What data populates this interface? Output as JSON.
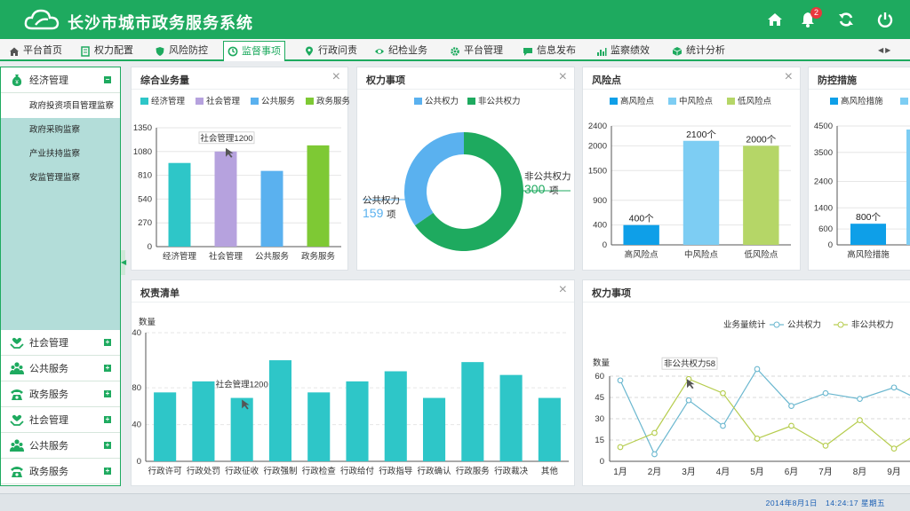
{
  "app": {
    "title": "长沙市城市政务服务系统",
    "notification_count": "2"
  },
  "header_icons": [
    "home-icon",
    "bell-icon",
    "refresh-icon",
    "power-icon"
  ],
  "tabs": [
    {
      "label": "平台首页",
      "icon": "home-icon"
    },
    {
      "label": "权力配置",
      "icon": "document-icon"
    },
    {
      "label": "风险防控",
      "icon": "shield-icon"
    },
    {
      "label": "监督事项",
      "icon": "clock-icon",
      "active": true
    },
    {
      "label": "行政问责",
      "icon": "location-icon"
    },
    {
      "label": "纪检业务",
      "icon": "eye-icon"
    },
    {
      "label": "平台管理",
      "icon": "gear-icon"
    },
    {
      "label": "信息发布",
      "icon": "chat-icon"
    },
    {
      "label": "监察绩效",
      "icon": "bar-chart-icon"
    },
    {
      "label": "统计分析",
      "icon": "cube-icon"
    }
  ],
  "sidebar": {
    "sections": [
      {
        "label": "经济管理",
        "icon": "money-bag-icon",
        "toggle": "−",
        "expanded": true
      },
      {
        "label": "社会管理",
        "icon": "heart-hands-icon",
        "toggle": "+"
      },
      {
        "label": "公共服务",
        "icon": "people-icon",
        "toggle": "+"
      },
      {
        "label": "政务服务",
        "icon": "phone-icon",
        "toggle": "+"
      },
      {
        "label": "社会管理",
        "icon": "heart-hands-icon",
        "toggle": "+"
      },
      {
        "label": "公共服务",
        "icon": "people-icon",
        "toggle": "+"
      },
      {
        "label": "政务服务",
        "icon": "phone-icon",
        "toggle": "+"
      }
    ],
    "sub_items": [
      "政府投资项目管理监察",
      "政府采购监察",
      "产业扶持监察",
      "安监管理监察"
    ],
    "active_sub": 0
  },
  "panels": {
    "business": {
      "title": "综合业务量",
      "close": "×"
    },
    "power": {
      "title": "权力事项",
      "close": "×"
    },
    "risk": {
      "title": "风险点",
      "close": "×"
    },
    "prevention": {
      "title": "防控措施"
    },
    "list": {
      "title": "权责清单",
      "close": "×"
    },
    "power_trend": {
      "title": "权力事项"
    }
  },
  "colors": {
    "primary": "#1eaa5f",
    "teal": "#2ec6c8",
    "purple": "#b6a2de",
    "blue": "#5ab1ef",
    "green": "#7ec934",
    "deep_blue": "#0e9fe8",
    "light_blue": "#7dcdf3",
    "light_green": "#b5d667"
  },
  "chart_data": [
    {
      "id": "business",
      "type": "bar",
      "categories": [
        "经济管理",
        "社会管理",
        "公共服务",
        "政务服务"
      ],
      "values": [
        950,
        1080,
        860,
        1150
      ],
      "colors": [
        "#2ec6c8",
        "#b6a2de",
        "#5ab1ef",
        "#7ec934"
      ],
      "ylim": [
        0,
        1350
      ],
      "yticks": [
        "0",
        "270",
        "540",
        "810",
        "1080",
        "1350"
      ],
      "legend": [
        "经济管理",
        "社会管理",
        "公共服务",
        "政务服务"
      ],
      "tooltip": "社会管理1200",
      "grid": true
    },
    {
      "id": "power",
      "type": "pie",
      "legend": [
        "公共权力",
        "非公共权力"
      ],
      "slices": [
        {
          "name": "公共权力",
          "value": 159,
          "color": "#5ab1ef",
          "label_name": "公共权力",
          "label_value": "159",
          "unit": "项"
        },
        {
          "name": "非公共权力",
          "value": 300,
          "color": "#1eaa5f",
          "label_name": "非公共权力",
          "label_value": "300",
          "unit": "项"
        }
      ]
    },
    {
      "id": "risk",
      "type": "bar",
      "categories": [
        "高风险点",
        "中风险点",
        "低风险点"
      ],
      "values": [
        400,
        2100,
        2000
      ],
      "labels": [
        "400个",
        "2100个",
        "2000个"
      ],
      "colors": [
        "#0e9fe8",
        "#7dcdf3",
        "#b5d667"
      ],
      "ylim": [
        0,
        2400
      ],
      "yticks": [
        "0",
        "400",
        "900",
        "1500",
        "2000",
        "2400"
      ],
      "legend": [
        "高风险点",
        "中风险点",
        "低风险点"
      ],
      "grid": true
    },
    {
      "id": "prevention",
      "type": "bar",
      "categories": [
        "高风险措施"
      ],
      "values": [
        800
      ],
      "labels": [
        "800个"
      ],
      "colors": [
        "#0e9fe8"
      ],
      "ylim": [
        0,
        4500
      ],
      "yticks": [
        "0",
        "600",
        "1400",
        "2400",
        "3500",
        "4500"
      ],
      "legend": [
        "高风险措施"
      ],
      "grid": true
    },
    {
      "id": "list",
      "type": "bar",
      "categories": [
        "行政许可",
        "行政处罚",
        "行政征收",
        "行政强制",
        "行政检查",
        "行政给付",
        "行政指导",
        "行政确认",
        "行政服务",
        "行政裁决",
        "其他"
      ],
      "values": [
        75,
        87,
        69,
        110,
        75,
        87,
        98,
        69,
        108,
        94,
        69
      ],
      "color": "#2ec6c8",
      "ylim": [
        0,
        140
      ],
      "yticks": [
        "0",
        "40",
        "80",
        "140"
      ],
      "ylabel": "数量",
      "tooltip": "社会管理1200",
      "grid": true
    },
    {
      "id": "power_trend",
      "type": "line",
      "categories": [
        "1月",
        "2月",
        "3月",
        "4月",
        "5月",
        "6月",
        "7月",
        "8月",
        "9月"
      ],
      "legend_title": "业务量统计",
      "series": [
        {
          "name": "公共权力",
          "values": [
            57,
            5,
            43,
            25,
            65,
            39,
            48,
            44,
            52
          ],
          "color": "#6ab7cf"
        },
        {
          "name": "非公共权力",
          "values": [
            10,
            20,
            58,
            48,
            16,
            25,
            11,
            29,
            9
          ],
          "color": "#b5cc4c"
        }
      ],
      "ylim": [
        0,
        60
      ],
      "yticks": [
        "0",
        "15",
        "30",
        "45",
        "60"
      ],
      "ylabel": "数量",
      "tooltip": "非公共权力58",
      "grid": true
    }
  ],
  "footer": {
    "datetime": "2014年8月1日　14:24:17  星期五"
  }
}
